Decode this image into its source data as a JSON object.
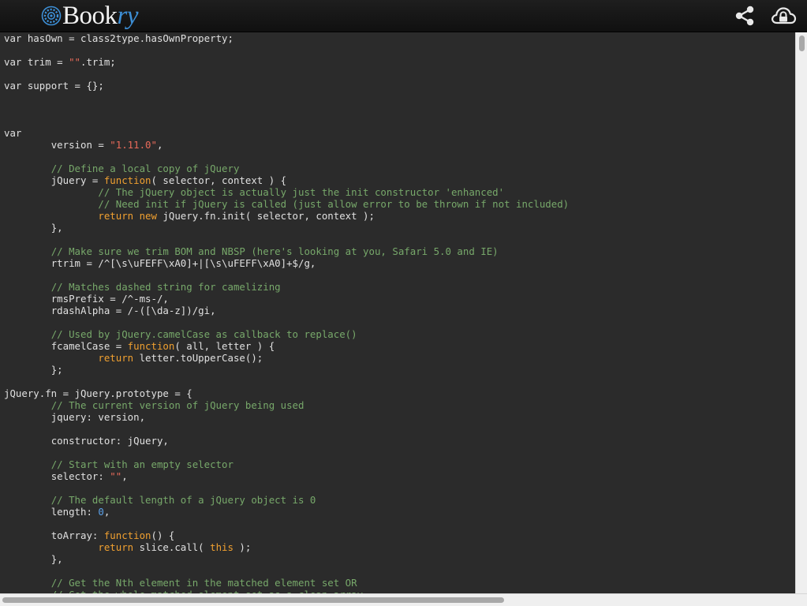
{
  "app": {
    "logo_main": "Book",
    "logo_accent": "ry"
  },
  "toolbar": {
    "icons": [
      "share-icon",
      "cloud-upload-icon"
    ]
  },
  "colors": {
    "background": "#2b2b2b",
    "text": "#e0e0e0",
    "keyword": "#f0a030",
    "comment": "#77a86a",
    "string": "#e86a5a",
    "number": "#5aa0e8",
    "logo_accent": "#3d8fd6"
  },
  "code": {
    "lines": [
      [
        [
          "",
          "var"
        ],
        [
          "",
          " hasOwn = class2type.hasOwnProperty;"
        ]
      ],
      [],
      [
        [
          "",
          "var"
        ],
        [
          "",
          " trim = "
        ],
        [
          "st",
          "\"\""
        ],
        [
          "",
          ".trim;"
        ]
      ],
      [],
      [
        [
          "",
          "var"
        ],
        [
          "",
          " support = {};"
        ]
      ],
      [],
      [],
      [],
      [
        [
          "",
          "var"
        ]
      ],
      [
        [
          "",
          "\tversion = "
        ],
        [
          "st",
          "\"1.11.0\""
        ],
        [
          "",
          ","
        ]
      ],
      [],
      [
        [
          "cm",
          "\t// Define a local copy of jQuery"
        ]
      ],
      [
        [
          "",
          "\tjQuery = "
        ],
        [
          "kw",
          "function"
        ],
        [
          "",
          "( selector, context ) {"
        ]
      ],
      [
        [
          "cm",
          "\t\t// The jQuery object is actually just the init constructor 'enhanced'"
        ]
      ],
      [
        [
          "cm",
          "\t\t// Need init if jQuery is called (just allow error to be thrown if not included)"
        ]
      ],
      [
        [
          "kw",
          "\t\treturn new"
        ],
        [
          "",
          " jQuery.fn.init( selector, context );"
        ]
      ],
      [
        [
          "",
          "\t},"
        ]
      ],
      [],
      [
        [
          "cm",
          "\t// Make sure we trim BOM and NBSP (here's looking at you, Safari 5.0 and IE)"
        ]
      ],
      [
        [
          "",
          "\trtrim = /^[\\s\\uFEFF\\xA0]+|[\\s\\uFEFF\\xA0]+$/g,"
        ]
      ],
      [],
      [
        [
          "cm",
          "\t// Matches dashed string for camelizing"
        ]
      ],
      [
        [
          "",
          "\trmsPrefix = /^-ms-/,"
        ]
      ],
      [
        [
          "",
          "\trdashAlpha = /-([\\da-z])/gi,"
        ]
      ],
      [],
      [
        [
          "cm",
          "\t// Used by jQuery.camelCase as callback to replace()"
        ]
      ],
      [
        [
          "",
          "\tfcamelCase = "
        ],
        [
          "kw",
          "function"
        ],
        [
          "",
          "( all, letter ) {"
        ]
      ],
      [
        [
          "kw",
          "\t\treturn"
        ],
        [
          "",
          " letter.toUpperCase();"
        ]
      ],
      [
        [
          "",
          "\t};"
        ]
      ],
      [],
      [
        [
          "",
          "jQuery.fn = jQuery.prototype = {"
        ]
      ],
      [
        [
          "cm",
          "\t// The current version of jQuery being used"
        ]
      ],
      [
        [
          "",
          "\tjquery: version,"
        ]
      ],
      [],
      [
        [
          "",
          "\tconstructor: jQuery,"
        ]
      ],
      [],
      [
        [
          "cm",
          "\t// Start with an empty selector"
        ]
      ],
      [
        [
          "",
          "\tselector: "
        ],
        [
          "st",
          "\"\""
        ],
        [
          "",
          ","
        ]
      ],
      [],
      [
        [
          "cm",
          "\t// The default length of a jQuery object is 0"
        ]
      ],
      [
        [
          "",
          "\tlength: "
        ],
        [
          "nm",
          "0"
        ],
        [
          "",
          ","
        ]
      ],
      [],
      [
        [
          "",
          "\ttoArray: "
        ],
        [
          "kw",
          "function"
        ],
        [
          "",
          "() {"
        ]
      ],
      [
        [
          "kw",
          "\t\treturn"
        ],
        [
          "",
          " slice.call( "
        ],
        [
          "kw",
          "this"
        ],
        [
          "",
          " );"
        ]
      ],
      [
        [
          "",
          "\t},"
        ]
      ],
      [],
      [
        [
          "cm",
          "\t// Get the Nth element in the matched element set OR"
        ]
      ],
      [
        [
          "cm",
          "\t// Get the whole matched element set as a clean array"
        ]
      ]
    ]
  }
}
